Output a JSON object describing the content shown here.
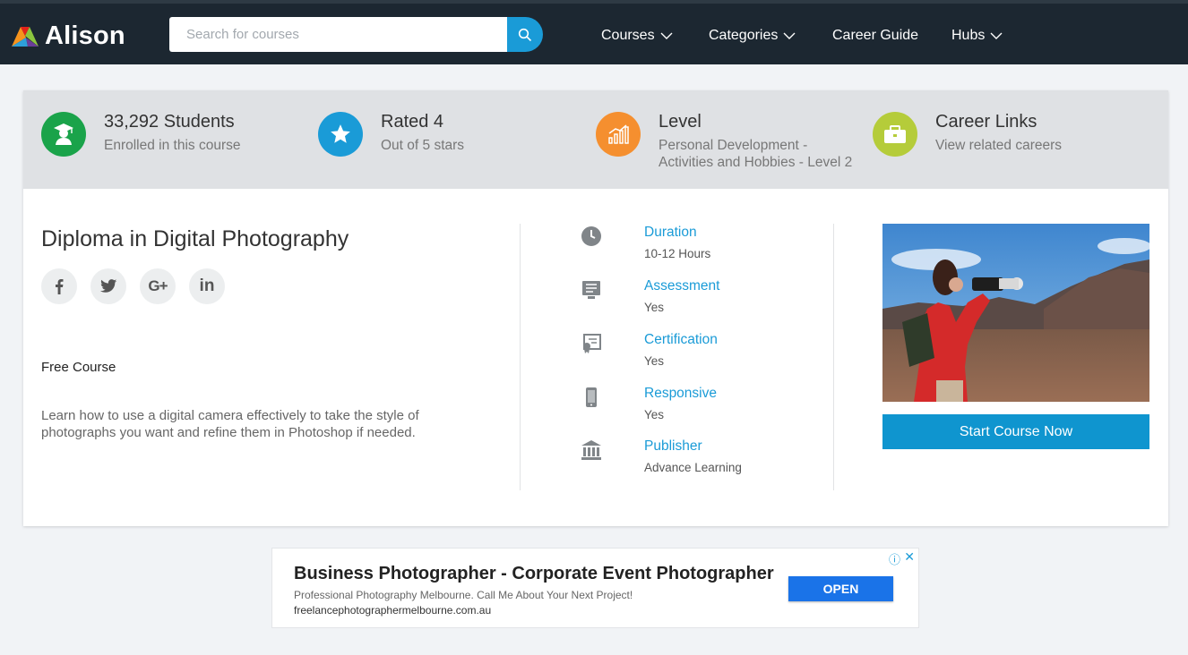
{
  "header": {
    "brand": "Alison",
    "search": {
      "placeholder": "Search for courses",
      "value": ""
    },
    "nav": [
      "Courses",
      "Categories",
      "Career Guide",
      "Hubs"
    ]
  },
  "stats": [
    {
      "title": "33,292 Students",
      "sub": "Enrolled in this course",
      "icon": "graduate-icon",
      "color": "#1aa34a"
    },
    {
      "title": "Rated 4",
      "sub": "Out of 5 stars",
      "icon": "star-icon",
      "color": "#1a9bd7"
    },
    {
      "title": "Level",
      "sub": "Personal Development - Activities and Hobbies - Level 2",
      "icon": "bar-chart-icon",
      "color": "#f58f2f"
    },
    {
      "title": "Career Links",
      "sub": "View related careers",
      "icon": "briefcase-icon",
      "color": "#b5cc3a"
    }
  ],
  "course": {
    "title": "Diploma in Digital Photography",
    "price_label": "Free Course",
    "description": "Learn how to use a digital camera effectively to take the style of photographs you want and refine them in Photoshop if needed.",
    "socials": [
      "facebook-icon",
      "twitter-icon",
      "google-plus-icon",
      "linkedin-icon"
    ]
  },
  "meta": [
    {
      "label": "Duration",
      "value": "10-12 Hours",
      "icon": "clock-icon"
    },
    {
      "label": "Assessment",
      "value": "Yes",
      "icon": "assessment-icon"
    },
    {
      "label": "Certification",
      "value": "Yes",
      "icon": "certificate-icon"
    },
    {
      "label": "Responsive",
      "value": "Yes",
      "icon": "mobile-icon"
    },
    {
      "label": "Publisher",
      "value": "Advance Learning",
      "icon": "institution-icon"
    }
  ],
  "cta": {
    "label": "Start Course Now"
  },
  "ad": {
    "title": "Business Photographer - Corporate Event Photographer",
    "description": "Professional Photography Melbourne. Call Me About Your Next Project!",
    "url": "freelancephotographermelbourne.com.au",
    "button": "OPEN",
    "close": "✕",
    "info": "ⓘ"
  },
  "colors": {
    "accent": "#1a9bd7",
    "header_bg": "#1c2731",
    "cta": "#0f95cf"
  }
}
